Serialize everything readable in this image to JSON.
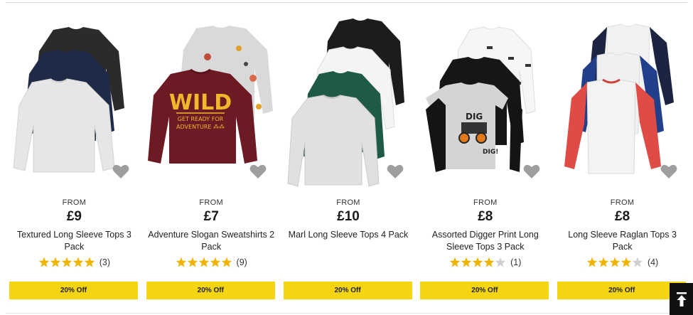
{
  "colors": {
    "offer_bg": "#f5d414",
    "star_filled": "#f0b400",
    "star_empty": "#cfcfcf",
    "heart": "#9e9e9e"
  },
  "products": [
    {
      "from_label": "FROM",
      "price": "£9",
      "title": "Textured Long Sleeve Tops 3 Pack",
      "rating": 5,
      "reviews": "(3)",
      "offer": "20% Off",
      "wishlist_icon": "heart-icon"
    },
    {
      "from_label": "FROM",
      "price": "£7",
      "title": "Adventure Slogan Sweatshirts 2 Pack",
      "rating": 5,
      "reviews": "(9)",
      "offer": "20% Off",
      "wishlist_icon": "heart-icon",
      "graphic_text": {
        "line1": "WILD",
        "line2": "GET READY FOR",
        "line3": "ADVENTURE ⁂⁂"
      }
    },
    {
      "from_label": "FROM",
      "price": "£10",
      "title": "Marl Long Sleeve Tops 4 Pack",
      "rating": null,
      "reviews": "",
      "offer": "20% Off",
      "wishlist_icon": "heart-icon"
    },
    {
      "from_label": "FROM",
      "price": "£8",
      "title": "Assorted Digger Print Long Sleeve Tops 3 Pack",
      "rating": 4,
      "reviews": "(1)",
      "offer": "20% Off",
      "wishlist_icon": "heart-icon",
      "graphic_text": {
        "line1": "DIG",
        "line2": "DIG!"
      }
    },
    {
      "from_label": "FROM",
      "price": "£8",
      "title": "Long Sleeve Raglan Tops 3 Pack",
      "rating": 4,
      "reviews": "(4)",
      "offer": "20% Off",
      "wishlist_icon": "heart-icon"
    }
  ],
  "back_to_top_icon": "arrow-up-to-line-icon"
}
